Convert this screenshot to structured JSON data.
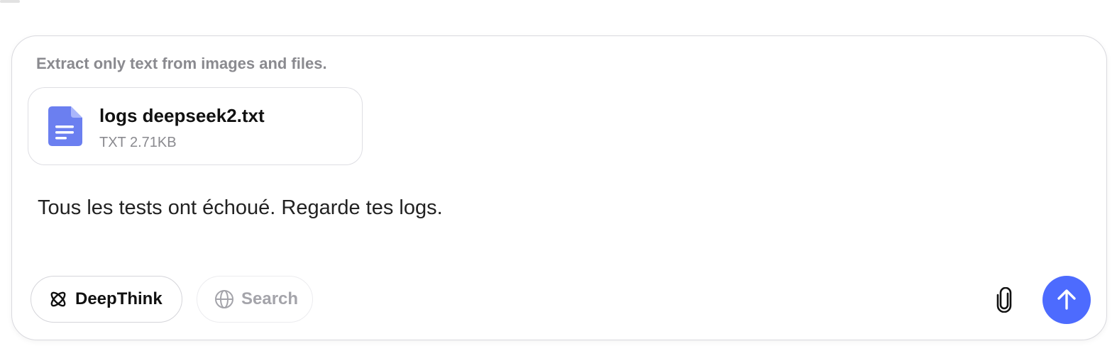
{
  "composer": {
    "hint": "Extract only text from images and files.",
    "attachment": {
      "name": "logs deepseek2.txt",
      "meta": "TXT 2.71KB",
      "icon": "document-icon",
      "icon_color": "#6b7ff0"
    },
    "message": "Tous les tests ont échoué. Regarde tes logs."
  },
  "toolbar": {
    "deepthink_label": "DeepThink",
    "deepthink_icon": "atom-icon",
    "search_label": "Search",
    "search_icon": "globe-icon",
    "attach_icon": "paperclip-icon",
    "send_icon": "arrow-up-icon",
    "accent": "#4d6bfe"
  }
}
